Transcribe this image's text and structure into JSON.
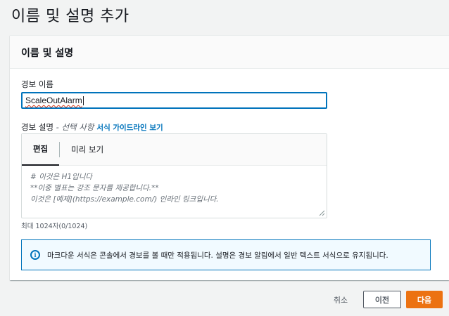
{
  "page": {
    "title": "이름 및 설명 추가"
  },
  "card": {
    "header": "이름 및 설명"
  },
  "alarm_name": {
    "label": "경보 이름",
    "value": "ScaleOutAlarm"
  },
  "description": {
    "label": "경보 설명",
    "optional": " - 선택 사항",
    "guide_link": "서식 가이드라인 보기",
    "tabs": [
      "편집",
      "미리 보기"
    ],
    "active_tab": "편집",
    "placeholder_lines": [
      "# 이것은 H1입니다",
      "**이중 별표는 강조 문자를 제공합니다.**",
      "이것은 [예제](https://example.com/) 인라인 링크입니다."
    ],
    "counter": "최대 1024자(0/1024)"
  },
  "info": {
    "icon": "info-icon",
    "text": "마크다운 서식은 콘솔에서 경보를 볼 때만 적용됩니다. 설명은 경보 알림에서 일반 텍스트 서식으로 유지됩니다."
  },
  "footer": {
    "cancel": "취소",
    "previous": "이전",
    "next": "다음"
  },
  "colors": {
    "accent": "#0073bb",
    "primary_button": "#ec7211",
    "spell_error": "#d13212"
  }
}
